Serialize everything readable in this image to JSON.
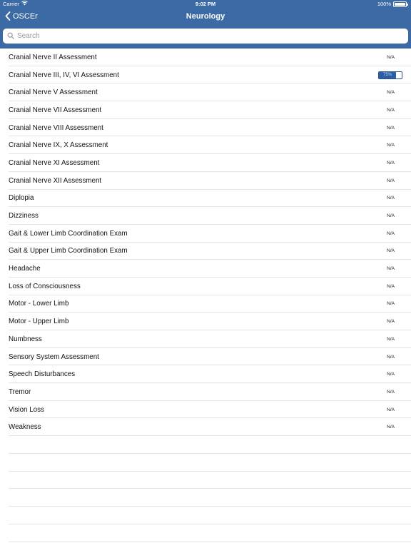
{
  "status_bar": {
    "carrier": "Carrier",
    "wifi_icon": "wifi-icon",
    "time": "9:02 PM",
    "battery_text": "100%",
    "battery_level": 1.0
  },
  "nav": {
    "back_label": "OSCEr",
    "title": "Neurology"
  },
  "search": {
    "placeholder": "Search",
    "value": ""
  },
  "colors": {
    "nav_background": "#3b6aa4",
    "badge_fill": "#2a5fa6"
  },
  "items": [
    {
      "label": "Cranial Nerve II Assessment",
      "value": "N/A"
    },
    {
      "label": "Cranial Nerve III, IV, VI Assessment",
      "value": "",
      "badge_text": "75%",
      "progress": 0.75
    },
    {
      "label": "Cranial Nerve V Assessment",
      "value": "N/A"
    },
    {
      "label": "Cranial Nerve VII Assessment",
      "value": "N/A"
    },
    {
      "label": "Cranial Nerve VIII Assessment",
      "value": "N/A"
    },
    {
      "label": "Cranial Nerve IX, X Assessment",
      "value": "N/A"
    },
    {
      "label": "Cranial Nerve XI Assessment",
      "value": "N/A"
    },
    {
      "label": "Cranial Nerve XII Assessment",
      "value": "N/A"
    },
    {
      "label": "Diplopia",
      "value": "N/A"
    },
    {
      "label": "Dizziness",
      "value": "N/A"
    },
    {
      "label": "Gait & Lower Limb Coordination Exam",
      "value": "N/A"
    },
    {
      "label": "Gait & Upper Limb Coordination Exam",
      "value": "N/A"
    },
    {
      "label": "Headache",
      "value": "N/A"
    },
    {
      "label": "Loss of Consciousness",
      "value": "N/A"
    },
    {
      "label": "Motor - Lower Limb",
      "value": "N/A"
    },
    {
      "label": "Motor - Upper Limb",
      "value": "N/A"
    },
    {
      "label": "Numbness",
      "value": "N/A"
    },
    {
      "label": "Sensory System Assessment",
      "value": "N/A"
    },
    {
      "label": "Speech Disturbances",
      "value": "N/A"
    },
    {
      "label": "Tremor",
      "value": "N/A"
    },
    {
      "label": "Vision Loss",
      "value": "N/A"
    },
    {
      "label": "Weakness",
      "value": "N/A"
    }
  ]
}
